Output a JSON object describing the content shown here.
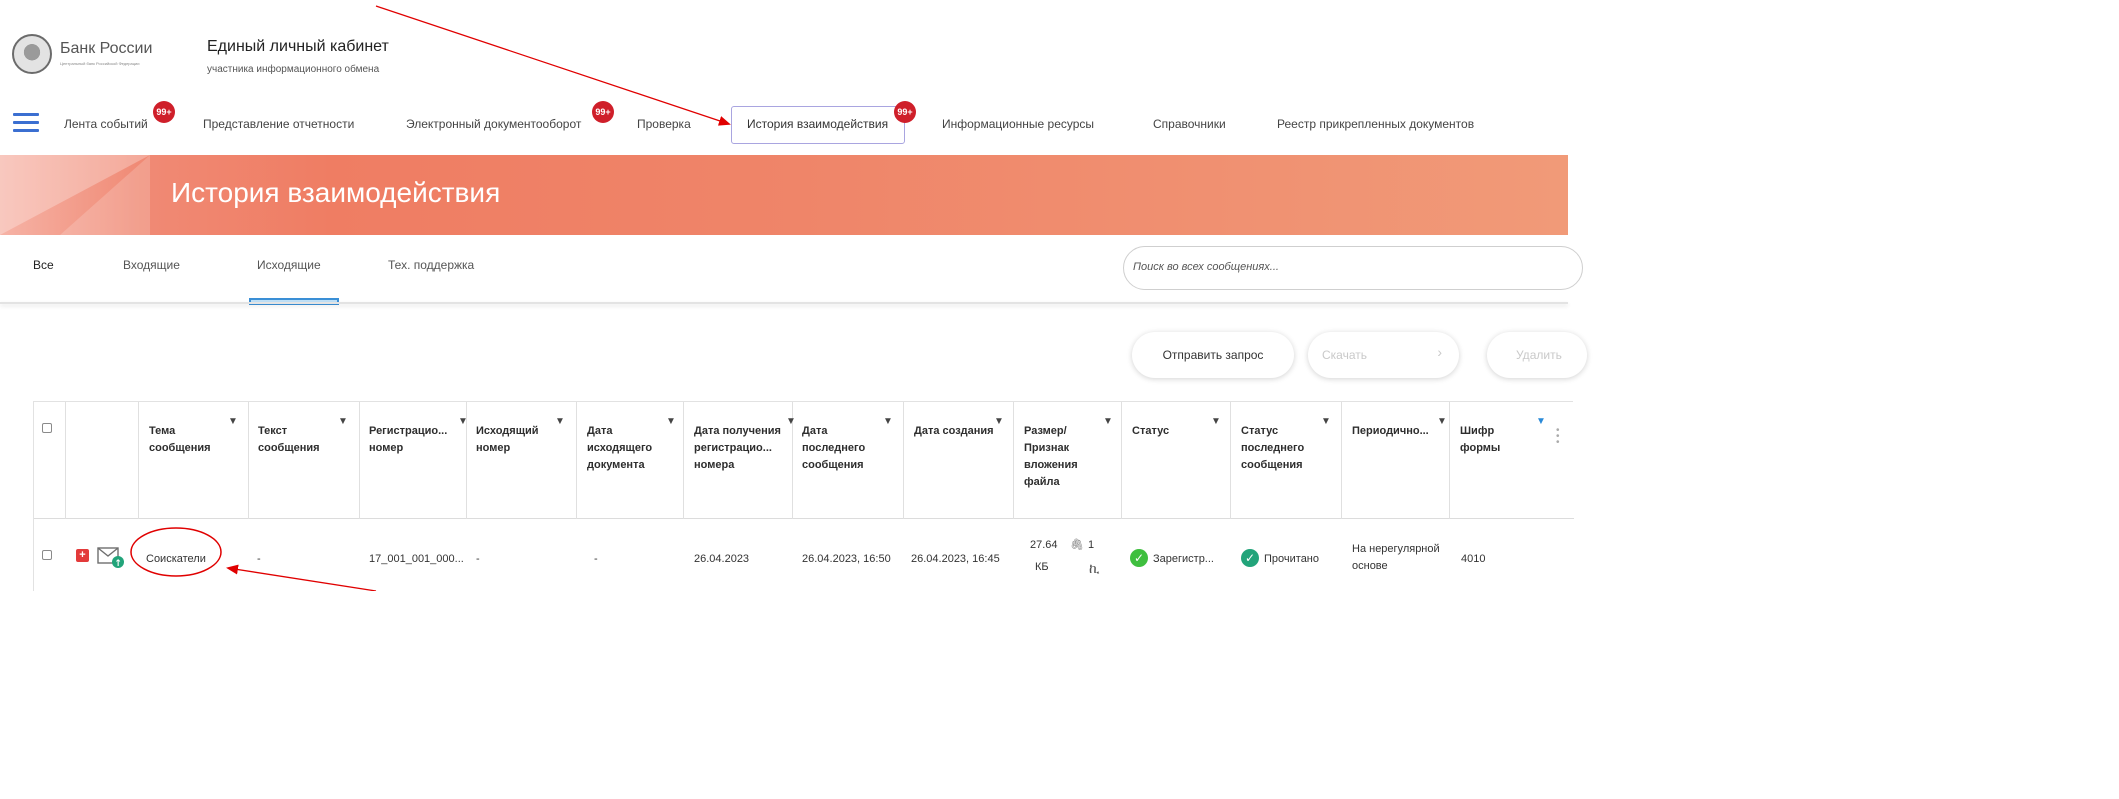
{
  "header": {
    "org_name": "Банк России",
    "org_subtitle": "Центральный банк Российской Федерации",
    "cabinet_title": "Единый личный кабинет",
    "cabinet_subtitle": "участника информационного обмена"
  },
  "nav": {
    "items": [
      {
        "label": "Лента событий",
        "badge": "99+"
      },
      {
        "label": "Представление отчетности"
      },
      {
        "label": "Электронный документооборот",
        "badge": "99+"
      },
      {
        "label": "Проверка"
      },
      {
        "label": "История взаимодействия",
        "badge": "99+",
        "active": true
      },
      {
        "label": "Информационные ресурсы"
      },
      {
        "label": "Справочники"
      },
      {
        "label": "Реестр прикрепленных документов"
      }
    ]
  },
  "page": {
    "title": "История взаимодействия"
  },
  "tabs": [
    {
      "label": "Все"
    },
    {
      "label": "Входящие"
    },
    {
      "label": "Исходящие",
      "active": true
    },
    {
      "label": "Тех. поддержка"
    }
  ],
  "search": {
    "placeholder": "Поиск во всех сообщениях..."
  },
  "actions": {
    "send_request": "Отправить запрос",
    "download": "Скачать",
    "delete": "Удалить"
  },
  "table": {
    "columns": [
      {
        "label": "Тема сообщения"
      },
      {
        "label": "Текст сообщения"
      },
      {
        "label": "Регистрацио... номер"
      },
      {
        "label": "Исходящий номер"
      },
      {
        "label": "Дата исходящего документа"
      },
      {
        "label": "Дата получения регистрацио... номера"
      },
      {
        "label": "Дата последнего сообщения"
      },
      {
        "label": "Дата создания"
      },
      {
        "label": "Размер/ Признак вложения файла"
      },
      {
        "label": "Статус"
      },
      {
        "label": "Статус последнего сообщения"
      },
      {
        "label": "Периодично..."
      },
      {
        "label": "Шифр формы"
      }
    ],
    "rows": [
      {
        "subject": "Соискатели",
        "text": "-",
        "reg_number": "17_001_001_000...",
        "outgoing_number": "-",
        "outgoing_date": "-",
        "reg_received_date": "26.04.2023",
        "last_message_date": "26.04.2023, 16:50",
        "created_date": "26.04.2023, 16:45",
        "size_value": "27.64",
        "size_unit": "КБ",
        "attachments": "1",
        "status": "Зарегистр...",
        "last_status": "Прочитано",
        "periodicity": "На нерегулярной основе",
        "form_code": "4010"
      }
    ]
  },
  "colors": {
    "accent_blue": "#3b6fd1",
    "badge_red": "#cf1f2a",
    "banner_orange": "#ef7d63",
    "annotation_red": "#e00000",
    "status_green": "#3fbf3f"
  }
}
